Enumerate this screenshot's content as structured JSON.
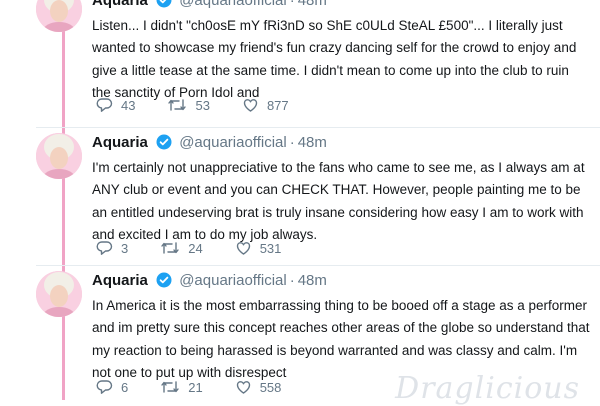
{
  "tweets": [
    {
      "name": "Aquaria",
      "handle": "@aquariaofficial",
      "time": "48m",
      "text": "Listen... I didn't \"ch0osE mY fRi3nD so ShE c0ULd SteAL £500\"... I literally just wanted to showcase my friend's fun crazy dancing self for the crowd to enjoy and give a little tease at the same time. I didn't mean to come up into the club to ruin the sanctity of Porn Idol and",
      "replies": "43",
      "retweets": "53",
      "likes": "877"
    },
    {
      "name": "Aquaria",
      "handle": "@aquariaofficial",
      "time": "48m",
      "text": "I'm certainly not unappreciative to the fans who came to see me, as I always am at ANY club or event and you can CHECK THAT. However, people painting me to be an entitled undeserving brat is truly insane considering how easy I am to work with and excited I am to do my job always.",
      "replies": "3",
      "retweets": "24",
      "likes": "531"
    },
    {
      "name": "Aquaria",
      "handle": "@aquariaofficial",
      "time": "48m",
      "text": "In America it is the most embarrassing thing to be booed off a stage as a performer and im pretty sure this concept reaches other areas of the globe so understand that my reaction to being harassed is beyond warranted and was classy and calm. I'm not one to put up with disrespect",
      "replies": "6",
      "retweets": "21",
      "likes": "558"
    }
  ],
  "separator": "·",
  "watermark": "Draglicious",
  "colors": {
    "thread_line": "#f0a3c5",
    "verified": "#1da1f2",
    "secondary_text": "#657786",
    "avatar_bg": "#f7c7db"
  },
  "icons": [
    "reply-icon",
    "retweet-icon",
    "like-icon",
    "verified-badge-icon"
  ]
}
